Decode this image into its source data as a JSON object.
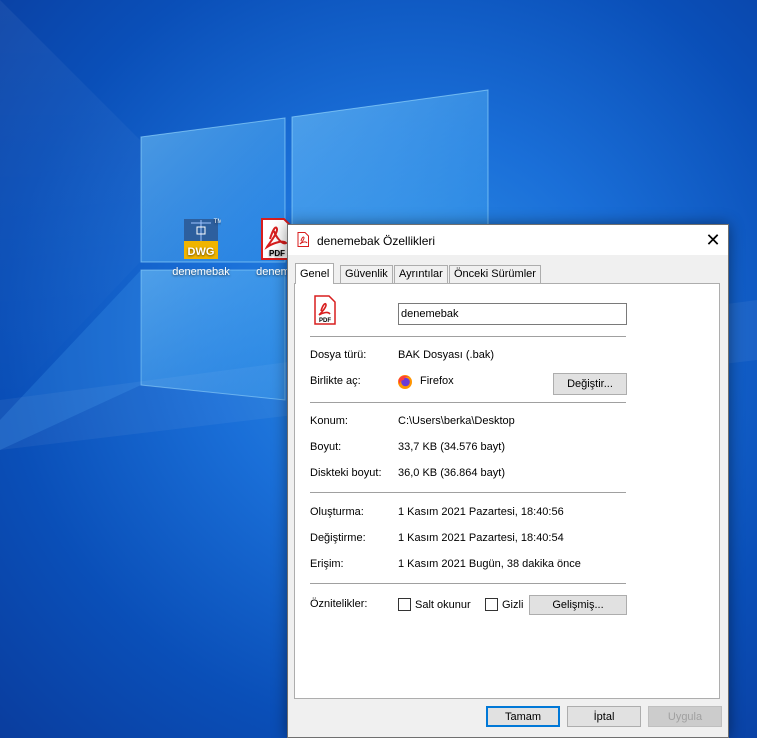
{
  "desktop": {
    "icons": [
      {
        "label": "denemebak",
        "badge": "DWG",
        "icon": "dwg-file-icon"
      },
      {
        "label": "deneme",
        "badge": "PDF",
        "icon": "pdf-file-icon"
      }
    ]
  },
  "dialog": {
    "title": "denemebak Özellikleri",
    "close_glyph": "✕",
    "tabs": [
      "Genel",
      "Güvenlik",
      "Ayrıntılar",
      "Önceki Sürümler"
    ],
    "active_tab": "Genel",
    "file_name": "denemebak",
    "file_type_label": "Dosya türü:",
    "file_type_value": "BAK Dosyası (.bak)",
    "opens_with_label": "Birlikte aç:",
    "opens_with_value": "Firefox",
    "change_button": "Değiştir...",
    "location_label": "Konum:",
    "location_value": "C:\\Users\\berka\\Desktop",
    "size_label": "Boyut:",
    "size_value": "33,7 KB (34.576 bayt)",
    "disk_size_label": "Diskteki boyut:",
    "disk_size_value": "36,0 KB (36.864 bayt)",
    "created_label": "Oluşturma:",
    "created_value": "1 Kasım 2021 Pazartesi, 18:40:56",
    "modified_label": "Değiştirme:",
    "modified_value": "1 Kasım 2021 Pazartesi, 18:40:54",
    "accessed_label": "Erişim:",
    "accessed_value": "1 Kasım 2021 Bugün, 38 dakika önce",
    "attributes_label": "Öznitelikler:",
    "readonly_label": "Salt okunur",
    "readonly_checked": false,
    "hidden_label": "Gizli",
    "hidden_checked": false,
    "advanced_button": "Gelişmiş...",
    "ok_button": "Tamam",
    "cancel_button": "İptal",
    "apply_button": "Uygula"
  },
  "colors": {
    "accent": "#0078d7",
    "pdf_red": "#d81e1e",
    "dwg_yellow": "#f0b400",
    "dwg_blue": "#2d5f9e"
  }
}
